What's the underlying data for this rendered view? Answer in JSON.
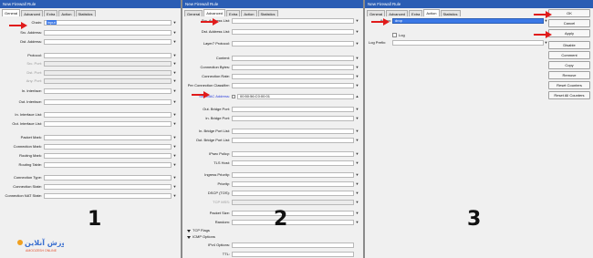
{
  "window_title": "New Firewall Rule",
  "panel1": {
    "tabs": [
      {
        "label": "General",
        "active": true
      },
      {
        "label": "Advanced",
        "active": false
      },
      {
        "label": "Extra",
        "active": false
      },
      {
        "label": "Action",
        "active": false
      },
      {
        "label": "Statistics",
        "active": false
      }
    ],
    "chain_label": "Chain:",
    "chain_value": "input",
    "fields": [
      {
        "label": "Src. Address:",
        "dim": false
      },
      {
        "label": "Dst. Address:",
        "dim": false
      },
      {
        "label": "Protocol:",
        "dim": false
      },
      {
        "label": "Src. Port:",
        "dim": true
      },
      {
        "label": "Dst. Port:",
        "dim": true
      },
      {
        "label": "Any. Port:",
        "dim": true
      },
      {
        "label": "In. Interface:",
        "dim": false
      },
      {
        "label": "Out. Interface:",
        "dim": false
      },
      {
        "label": "In. Interface List:",
        "dim": false
      },
      {
        "label": "Out. Interface List:",
        "dim": false
      },
      {
        "label": "Packet Mark:",
        "dim": false
      },
      {
        "label": "Connection Mark:",
        "dim": false
      },
      {
        "label": "Routing Mark:",
        "dim": false
      },
      {
        "label": "Routing Table:",
        "dim": false
      },
      {
        "label": "Connection Type:",
        "dim": false
      },
      {
        "label": "Connection State:",
        "dim": false
      },
      {
        "label": "Connection NAT State:",
        "dim": false
      }
    ],
    "number": "1"
  },
  "panel2": {
    "tabs": [
      {
        "label": "General",
        "active": false
      },
      {
        "label": "Advanced",
        "active": true
      },
      {
        "label": "Extra",
        "active": false
      },
      {
        "label": "Action",
        "active": false
      },
      {
        "label": "Statistics",
        "active": false
      }
    ],
    "fields": [
      {
        "label": "Src. Address List:"
      },
      {
        "label": "Dst. Address List:"
      },
      {
        "label": "Layer7 Protocol:"
      },
      {
        "label": "Content:"
      },
      {
        "label": "Connection Bytes:"
      },
      {
        "label": "Connection Rate:"
      },
      {
        "label": "Per Connection Classifier:"
      }
    ],
    "mac_label": "Src. MAC Address:",
    "mac_value": "00:50:56:C0:00:01",
    "fields2": [
      {
        "label": "Out. Bridge Port:"
      },
      {
        "label": "In. Bridge Port:"
      },
      {
        "label": "In. Bridge Port List:"
      },
      {
        "label": "Out. Bridge Port List:"
      },
      {
        "label": "IPsec Policy:"
      },
      {
        "label": "TLS Host:"
      },
      {
        "label": "Ingress Priority:"
      },
      {
        "label": "Priority:"
      },
      {
        "label": "DSCP (TOS):"
      },
      {
        "label": "TCP MSS:"
      },
      {
        "label": "Packet Size:"
      },
      {
        "label": "Random:"
      }
    ],
    "sections": [
      "TCP Flags",
      "ICMP Options"
    ],
    "icmp_label": "IPv4 Options:",
    "ttl_label": "TTL:",
    "number": "2"
  },
  "panel3": {
    "tabs": [
      {
        "label": "General",
        "active": false
      },
      {
        "label": "Advanced",
        "active": false
      },
      {
        "label": "Extra",
        "active": false
      },
      {
        "label": "Action",
        "active": true
      },
      {
        "label": "Statistics",
        "active": false
      }
    ],
    "action_label": "Action:",
    "action_value": "drop",
    "log_label": "Log",
    "log_prefix_label": "Log Prefix:",
    "number": "3"
  },
  "buttons": [
    "OK",
    "Cancel",
    "Apply",
    "Disable",
    "Comment",
    "Copy",
    "Remove",
    "Reset Counters",
    "Reset All Counters"
  ],
  "logo_text": "آموزش آنلاین",
  "logo_sub": "AMOOZESH ONLINE",
  "colors": {
    "titlebar": "#2a5db4",
    "arrow": "#e01b1b",
    "selection": "#3b78e6"
  }
}
